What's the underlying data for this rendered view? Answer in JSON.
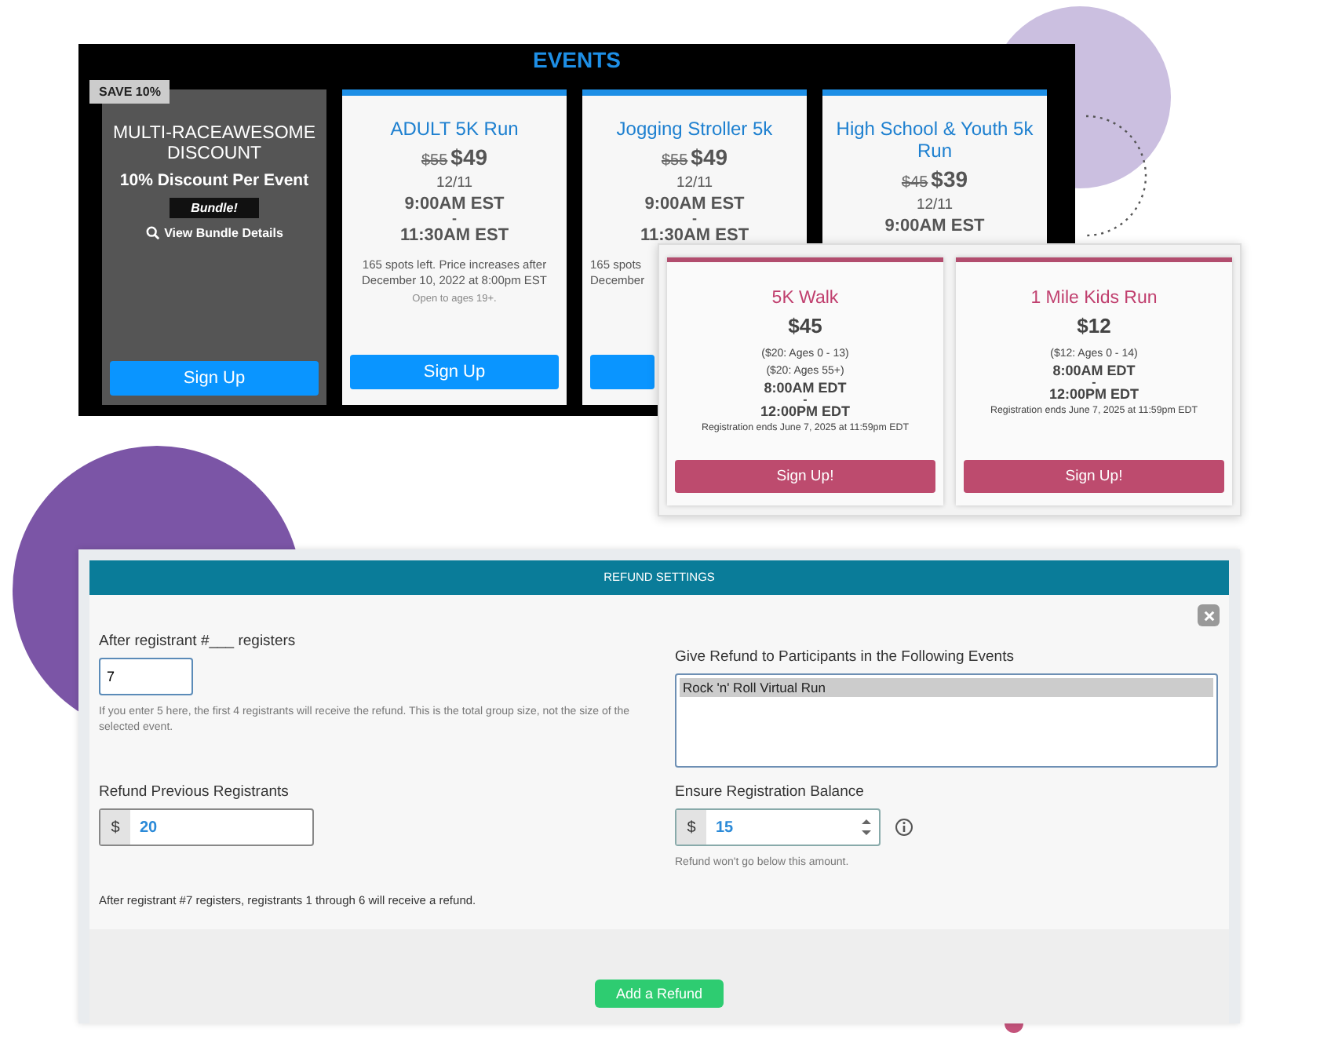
{
  "events_panel": {
    "title": "EVENTS",
    "bundle": {
      "ribbon": "SAVE 10%",
      "title": "MULTI-RACEAWESOME DISCOUNT",
      "subtitle": "10% Discount Per Event",
      "badge": "Bundle!",
      "link": "View Bundle Details",
      "button": "Sign Up"
    },
    "cards": [
      {
        "title": "ADULT 5K Run",
        "old_price": "$55",
        "price": "$49",
        "date": "12/11",
        "start": "9:00AM EST",
        "dash": "-",
        "end": "11:30AM EST",
        "notes": [
          "165 spots left. Price increases after December 10, 2022 at 8:00pm EST"
        ],
        "age": "Open to ages 19+.",
        "button": "Sign Up"
      },
      {
        "title": "Jogging Stroller 5k",
        "old_price": "$55",
        "price": "$49",
        "date": "12/11",
        "start": "9:00AM EST",
        "dash": "-",
        "end": "11:30AM EST",
        "notes": [
          "165 spots",
          "December"
        ],
        "button_stub": true
      },
      {
        "title": "High School & Youth 5k Run",
        "old_price": "$45",
        "price": "$39",
        "date": "12/11",
        "start": "9:00AM EST"
      }
    ]
  },
  "walk_panel": {
    "cards": [
      {
        "title": "5K Walk",
        "price": "$45",
        "tiers": [
          "($20: Ages 0 - 13)",
          "($20: Ages 55+)"
        ],
        "start": "8:00AM EDT",
        "dash": "-",
        "end": "12:00PM EDT",
        "note": "Registration ends June 7, 2025 at 11:59pm EDT",
        "button": "Sign Up!"
      },
      {
        "title": "1 Mile Kids Run",
        "price": "$12",
        "tiers": [
          "($12: Ages 0 - 14)"
        ],
        "start": "8:00AM EDT",
        "dash": "-",
        "end": "12:00PM EDT",
        "note": "Registration ends June 7, 2025 at 11:59pm EDT",
        "button": "Sign Up!"
      }
    ]
  },
  "refund_panel": {
    "title": "REFUND SETTINGS",
    "after": {
      "label": "After registrant #___ registers",
      "value": "7",
      "help": "If you enter 5 here, the first 4 registrants will receive the refund. This is the total group size, not the size of the selected event."
    },
    "events": {
      "label": "Give Refund to Participants in the Following Events",
      "options": [
        {
          "label": "Rock 'n' Roll Virtual Run",
          "selected": true
        }
      ]
    },
    "previous": {
      "label": "Refund Previous Registrants",
      "currency": "$",
      "value": "20"
    },
    "balance": {
      "label": "Ensure Registration Balance",
      "currency": "$",
      "value": "15",
      "hint": "Refund won't go below this amount."
    },
    "summary": "After registrant #7 registers, registrants 1 through 6 will receive a refund.",
    "button": "Add a Refund"
  }
}
